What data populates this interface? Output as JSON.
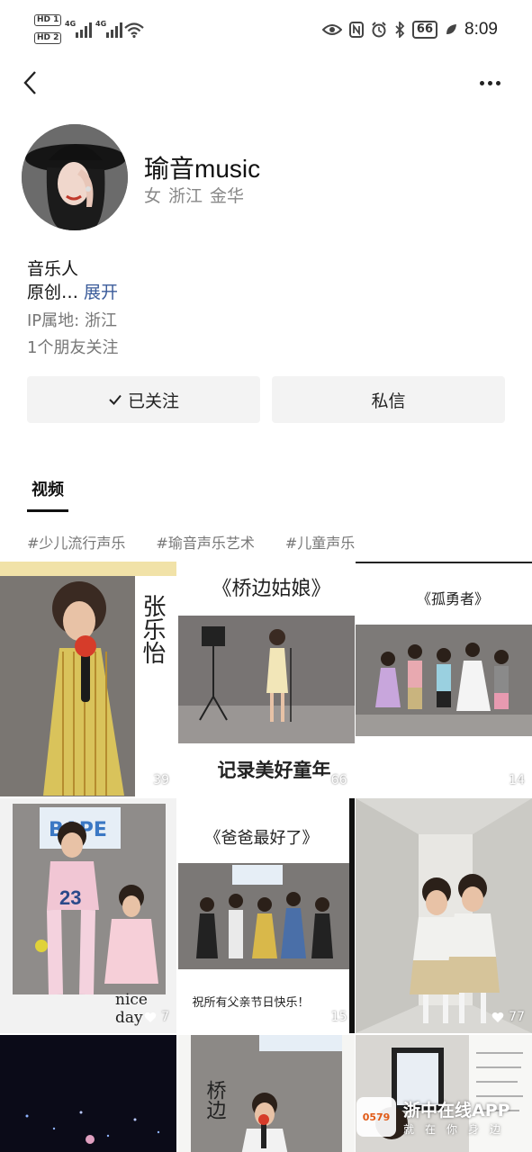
{
  "status_bar": {
    "sim1": "HD 1",
    "sim2": "HD 2",
    "signal_1": "4G",
    "signal_2": "4G",
    "battery": "66",
    "time": "8:09"
  },
  "profile": {
    "name": "瑜音music",
    "gender": "女",
    "province": "浙江",
    "city": "金华",
    "bio_title": "音乐人",
    "bio_preview": "原创…",
    "expand_label": "展开",
    "ip_location": "IP属地: 浙江",
    "friends_follow": "1个朋友关注"
  },
  "actions": {
    "following_label": "已关注",
    "message_label": "私信"
  },
  "tabs": {
    "video": "视频"
  },
  "tags": [
    "#少儿流行声乐",
    "#瑜音声乐艺术",
    "#儿童声乐"
  ],
  "videos": [
    {
      "caption": "张乐怡",
      "likes": "39"
    },
    {
      "caption": "《桥边姑娘》",
      "sub": "记录美好童年",
      "likes": "66"
    },
    {
      "caption": "《孤勇者》",
      "likes": "14"
    },
    {
      "caption": "nice day",
      "likes": "7"
    },
    {
      "caption": "《爸爸最好了》",
      "sub": "祝所有父亲节日快乐！",
      "likes": "15"
    },
    {
      "caption": "",
      "likes": "77"
    },
    {
      "caption": ""
    },
    {
      "caption": "桥边"
    },
    {
      "caption": ""
    }
  ],
  "watermark": {
    "app_name": "浙中在线APP",
    "tagline": "就在你身边",
    "logo_text": "0579"
  },
  "colors": {
    "link": "#3a5b9a",
    "button_bg": "#f3f3f3",
    "muted_text": "#888888"
  }
}
